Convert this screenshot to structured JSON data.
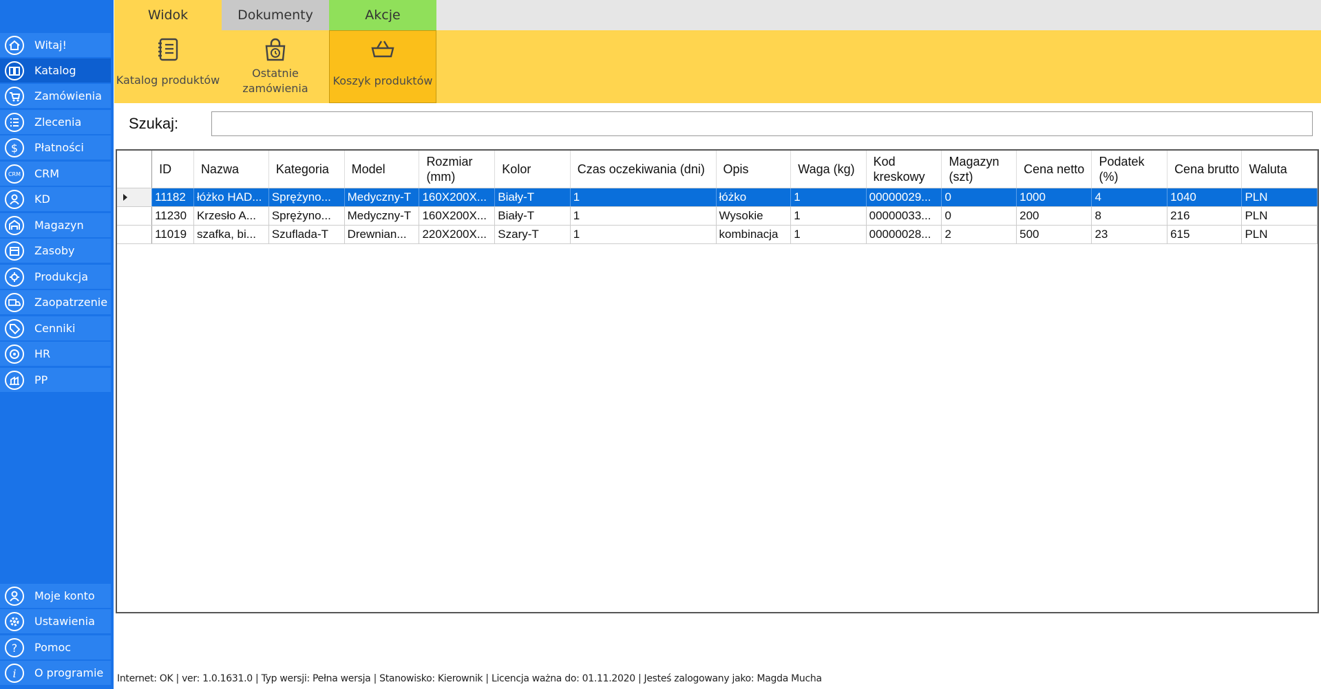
{
  "colors": {
    "sidebar": "#1a73e8",
    "ribbon": "#ffd54f",
    "tab_widok": "#ffd54f",
    "tab_dokumenty": "#c8c8c8",
    "tab_akcje": "#90e05a",
    "selected_row": "#0a6fdb"
  },
  "sidebar": {
    "items": [
      {
        "label": "Witaj!",
        "icon": "home-icon"
      },
      {
        "label": "Katalog",
        "icon": "book-icon"
      },
      {
        "label": "Zamówienia",
        "icon": "cart-icon"
      },
      {
        "label": "Zlecenia",
        "icon": "list-icon"
      },
      {
        "label": "Płatności",
        "icon": "dollar-icon"
      },
      {
        "label": "CRM",
        "icon": "crm-icon"
      },
      {
        "label": "KD",
        "icon": "person-icon"
      },
      {
        "label": "Magazyn",
        "icon": "warehouse-icon"
      },
      {
        "label": "Zasoby",
        "icon": "box-icon"
      },
      {
        "label": "Produkcja",
        "icon": "production-icon"
      },
      {
        "label": "Zaopatrzenie",
        "icon": "truck-icon"
      },
      {
        "label": "Cenniki",
        "icon": "tag-icon"
      },
      {
        "label": "HR",
        "icon": "hr-icon"
      },
      {
        "label": "PP",
        "icon": "pp-icon"
      }
    ],
    "bottom": [
      {
        "label": "Moje konto",
        "icon": "account-icon"
      },
      {
        "label": "Ustawienia",
        "icon": "gear-icon"
      },
      {
        "label": "Pomoc",
        "icon": "help-icon"
      },
      {
        "label": "O programie",
        "icon": "info-icon"
      }
    ]
  },
  "ribbon": {
    "tabs": [
      "Widok",
      "Dokumenty",
      "Akcje"
    ],
    "buttons": [
      {
        "label": "Katalog produktów",
        "icon": "catalog-icon"
      },
      {
        "label": "Ostatnie zamówienia",
        "icon": "recent-orders-icon"
      },
      {
        "label": "Koszyk produktów",
        "icon": "basket-icon"
      }
    ]
  },
  "search": {
    "label": "Szukaj:",
    "value": ""
  },
  "table": {
    "headers": [
      "ID",
      "Nazwa",
      "Kategoria",
      "Model",
      "Rozmiar (mm)",
      "Kolor",
      "Czas oczekiwania (dni)",
      "Opis",
      "Waga (kg)",
      "Kod kreskowy",
      "Magazyn (szt)",
      "Cena netto",
      "Podatek (%)",
      "Cena brutto",
      "Waluta"
    ],
    "rows": [
      [
        "11182",
        "łóżko HAD...",
        "Sprężyno...",
        "Medyczny-T",
        "160X200X...",
        "Biały-T",
        "1",
        "łóżko",
        "1",
        "00000029...",
        "0",
        "1000",
        "4",
        "1040",
        "PLN"
      ],
      [
        "11230",
        "Krzesło A...",
        "Sprężyno...",
        "Medyczny-T",
        "160X200X...",
        "Biały-T",
        "1",
        "Wysokie",
        "1",
        "00000033...",
        "0",
        "200",
        "8",
        "216",
        "PLN"
      ],
      [
        "11019",
        "szafka, bi...",
        "Szuflada-T",
        "Drewnian...",
        "220X200X...",
        "Szary-T",
        "1",
        "kombinacja",
        "1",
        "00000028...",
        "2",
        "500",
        "23",
        "615",
        "PLN"
      ]
    ]
  },
  "status_bar": {
    "text": "Internet: OK  |   ver: 1.0.1631.0   |   Typ wersji: Pełna wersja   |   Stanowisko: Kierownik   |   Licencja ważna do: 01.11.2020   |   Jesteś zalogowany jako: Magda Mucha"
  }
}
